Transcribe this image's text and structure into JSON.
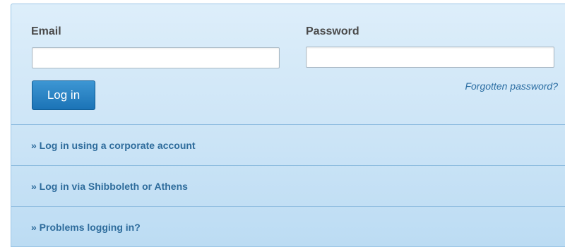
{
  "login": {
    "email_label": "Email",
    "password_label": "Password",
    "email_value": "",
    "password_value": "",
    "login_button": "Log in",
    "forgot_password": "Forgotten password?"
  },
  "options": [
    {
      "label": "» Log in using a corporate account"
    },
    {
      "label": "» Log in via Shibboleth or Athens"
    },
    {
      "label": "» Problems logging in?"
    }
  ],
  "colors": {
    "panel_background": "#cfe6f7",
    "button_background": "#1b73b6",
    "link_color": "#2e6c9c",
    "label_color": "#4a4a4a"
  }
}
